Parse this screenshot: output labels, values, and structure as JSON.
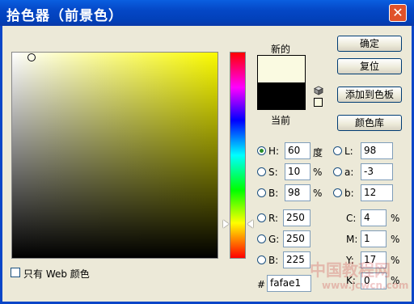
{
  "title": "拾色器（前景色）",
  "close_symbol": "✕",
  "swatch": {
    "new_label": "新的",
    "current_label": "当前",
    "new_color": "#fafae1",
    "current_color": "#000000"
  },
  "buttons": {
    "ok": "确定",
    "reset": "复位",
    "add_swatch": "添加到色板",
    "libraries": "颜色库"
  },
  "hsb": {
    "h": {
      "label": "H:",
      "value": "60",
      "unit": "度",
      "selected": true
    },
    "s": {
      "label": "S:",
      "value": "10",
      "unit": "%"
    },
    "b": {
      "label": "B:",
      "value": "98",
      "unit": "%"
    }
  },
  "lab": {
    "l": {
      "label": "L:",
      "value": "98"
    },
    "a": {
      "label": "a:",
      "value": "-3"
    },
    "b": {
      "label": "b:",
      "value": "12"
    }
  },
  "rgb": {
    "r": {
      "label": "R:",
      "value": "250"
    },
    "g": {
      "label": "G:",
      "value": "250"
    },
    "b": {
      "label": "B:",
      "value": "225"
    }
  },
  "cmyk": {
    "c": {
      "label": "C:",
      "value": "4",
      "unit": "%"
    },
    "m": {
      "label": "M:",
      "value": "1",
      "unit": "%"
    },
    "y": {
      "label": "Y:",
      "value": "17",
      "unit": "%"
    },
    "k": {
      "label": "K:",
      "value": "0",
      "unit": "%"
    }
  },
  "hex": {
    "label": "#",
    "value": "fafae1"
  },
  "web_only": {
    "label": "只有 Web 颜色",
    "checked": false
  },
  "watermark": {
    "line1": "中国教程网",
    "line2": "www.jcwcn.com"
  }
}
